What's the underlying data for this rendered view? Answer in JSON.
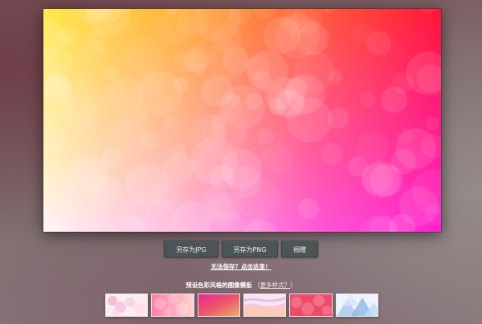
{
  "actions": {
    "save_jpg": "另存为JPG",
    "save_png": "另存为PNG",
    "donate": "捐赠"
  },
  "help": {
    "cant_save": "无法保存？点击这里！"
  },
  "presets": {
    "heading": "预设色彩风格的图像模板",
    "more": "更多样式？"
  },
  "colors": {
    "button_bg": "#4b5556",
    "preview_top_left": "#ffe84a",
    "preview_top_right": "#ff1a3a",
    "preview_bottom_left": "#fff3f6",
    "preview_bottom_right": "#ff2ad6"
  },
  "thumbnails": [
    {
      "name": "pastel-bokeh"
    },
    {
      "name": "pink-bokeh"
    },
    {
      "name": "sunset-gradient"
    },
    {
      "name": "pastel-waves"
    },
    {
      "name": "red-bokeh"
    },
    {
      "name": "blue-triangles"
    }
  ]
}
